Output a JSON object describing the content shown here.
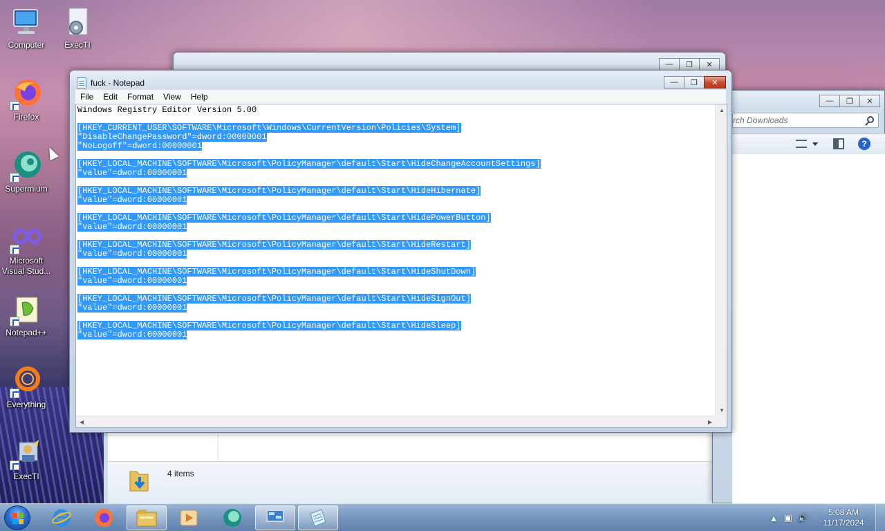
{
  "desktop": {
    "icons": [
      {
        "label": "Computer",
        "icon": "computer-icon"
      },
      {
        "label": "ExecTI",
        "icon": "execti-icon"
      },
      {
        "label": "Firefox",
        "icon": "firefox-icon"
      },
      {
        "label": "Supermium",
        "icon": "supermium-icon"
      },
      {
        "label": "Microsoft Visual Stud...",
        "icon": "visual-studio-icon"
      },
      {
        "label": "Notepad++",
        "icon": "notepadpp-icon"
      },
      {
        "label": "Everything",
        "icon": "everything-icon"
      },
      {
        "label": "ExecTI",
        "icon": "execti-shortcut-icon"
      }
    ]
  },
  "notepad": {
    "title": "fuck - Notepad",
    "menu": [
      "File",
      "Edit",
      "Format",
      "View",
      "Help"
    ],
    "lines": [
      {
        "text": "Windows Registry Editor Version 5.00",
        "selected": false
      },
      {
        "text": "",
        "selected": false
      },
      {
        "text": "[HKEY_CURRENT_USER\\SOFTWARE\\Microsoft\\Windows\\CurrentVersion\\Policies\\System]",
        "selected": true
      },
      {
        "text": "\"DisableChangePassword\"=dword:00000001",
        "selected": true
      },
      {
        "text": "\"NoLogoff\"=dword:00000001",
        "selected": true
      },
      {
        "text": "",
        "selected": true
      },
      {
        "text": "[HKEY_LOCAL_MACHINE\\SOFTWARE\\Microsoft\\PolicyManager\\default\\Start\\HideChangeAccountSettings]",
        "selected": true
      },
      {
        "text": "\"value\"=dword:00000001",
        "selected": true
      },
      {
        "text": "",
        "selected": true
      },
      {
        "text": "[HKEY_LOCAL_MACHINE\\SOFTWARE\\Microsoft\\PolicyManager\\default\\Start\\HideHibernate]",
        "selected": true
      },
      {
        "text": "\"value\"=dword:00000001",
        "selected": true
      },
      {
        "text": "",
        "selected": true
      },
      {
        "text": "[HKEY_LOCAL_MACHINE\\SOFTWARE\\Microsoft\\PolicyManager\\default\\Start\\HidePowerButton]",
        "selected": true
      },
      {
        "text": "\"value\"=dword:00000001",
        "selected": true
      },
      {
        "text": "",
        "selected": true
      },
      {
        "text": "[HKEY_LOCAL_MACHINE\\SOFTWARE\\Microsoft\\PolicyManager\\default\\Start\\HideRestart]",
        "selected": true
      },
      {
        "text": "\"value\"=dword:00000001",
        "selected": true
      },
      {
        "text": "",
        "selected": true
      },
      {
        "text": "[HKEY_LOCAL_MACHINE\\SOFTWARE\\Microsoft\\PolicyManager\\default\\Start\\HideShutDown]",
        "selected": true
      },
      {
        "text": "\"value\"=dword:00000001",
        "selected": true
      },
      {
        "text": "",
        "selected": true
      },
      {
        "text": "[HKEY_LOCAL_MACHINE\\SOFTWARE\\Microsoft\\PolicyManager\\default\\Start\\HideSignOut]",
        "selected": true
      },
      {
        "text": "\"value\"=dword:00000001",
        "selected": true
      },
      {
        "text": "",
        "selected": true
      },
      {
        "text": "[HKEY_LOCAL_MACHINE\\SOFTWARE\\Microsoft\\PolicyManager\\default\\Start\\HideSleep]",
        "selected": true
      },
      {
        "text": "\"value\"=dword:00000001",
        "selected": true
      }
    ],
    "selection_color": "#3399ff"
  },
  "explorer": {
    "search_placeholder": "rch Downloads",
    "status_items": "4 items"
  },
  "taskbar": {
    "pinned": [
      "internet-explorer-icon",
      "firefox-icon",
      "file-explorer-icon",
      "media-player-icon",
      "supermium-icon",
      "remote-desktop-icon",
      "notepad-icon"
    ],
    "clock_time": "5:08 AM",
    "clock_date": "11/17/2024"
  }
}
